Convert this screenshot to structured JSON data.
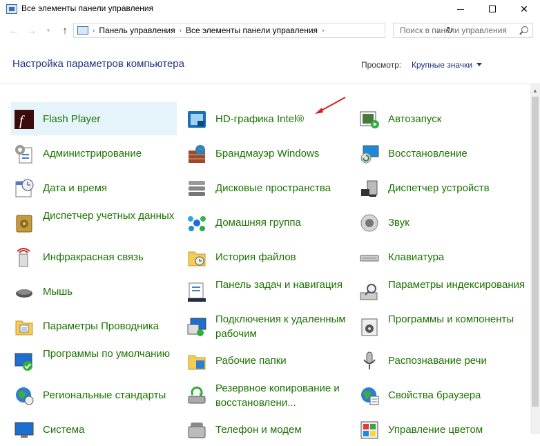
{
  "window": {
    "title": "Все элементы панели управления"
  },
  "address": {
    "crumbs": [
      "Панель управления",
      "Все элементы панели управления"
    ]
  },
  "search": {
    "placeholder": "Поиск в панели управления"
  },
  "header": {
    "title": "Настройка параметров компьютера",
    "view_label": "Просмотр:",
    "view_value": "Крупные значки"
  },
  "items": [
    {
      "label": "Flash Player",
      "icon": "flash-player-icon"
    },
    {
      "label": "HD-графика Intel®",
      "icon": "intel-graphics-icon"
    },
    {
      "label": "Автозапуск",
      "icon": "autoplay-icon"
    },
    {
      "label": "Администрирование",
      "icon": "administrative-tools-icon"
    },
    {
      "label": "Брандмауэр Windows",
      "icon": "firewall-icon"
    },
    {
      "label": "Восстановление",
      "icon": "recovery-icon"
    },
    {
      "label": "Дата и время",
      "icon": "date-time-icon"
    },
    {
      "label": "Дисковые пространства",
      "icon": "storage-spaces-icon"
    },
    {
      "label": "Диспетчер устройств",
      "icon": "device-manager-icon"
    },
    {
      "label": "Диспетчер учетных данных",
      "icon": "credential-manager-icon"
    },
    {
      "label": "Домашняя группа",
      "icon": "homegroup-icon"
    },
    {
      "label": "Звук",
      "icon": "sound-icon"
    },
    {
      "label": "Инфракрасная связь",
      "icon": "infrared-icon"
    },
    {
      "label": "История файлов",
      "icon": "file-history-icon"
    },
    {
      "label": "Клавиатура",
      "icon": "keyboard-icon"
    },
    {
      "label": "Мышь",
      "icon": "mouse-icon"
    },
    {
      "label": "Панель задач и навигация",
      "icon": "taskbar-icon"
    },
    {
      "label": "Параметры индексирования",
      "icon": "indexing-options-icon"
    },
    {
      "label": "Параметры Проводника",
      "icon": "explorer-options-icon"
    },
    {
      "label": "Подключения к удаленным рабочим",
      "icon": "remote-connections-icon"
    },
    {
      "label": "Программы и компоненты",
      "icon": "programs-features-icon"
    },
    {
      "label": "Программы по умолчанию",
      "icon": "default-programs-icon"
    },
    {
      "label": "Рабочие папки",
      "icon": "work-folders-icon"
    },
    {
      "label": "Распознавание речи",
      "icon": "speech-recognition-icon"
    },
    {
      "label": "Региональные стандарты",
      "icon": "region-icon"
    },
    {
      "label": "Резервное копирование и восстановлени...",
      "icon": "backup-restore-icon"
    },
    {
      "label": "Свойства браузера",
      "icon": "internet-options-icon"
    },
    {
      "label": "Система",
      "icon": "system-icon"
    },
    {
      "label": "Телефон и модем",
      "icon": "phone-modem-icon"
    },
    {
      "label": "Управление цветом",
      "icon": "color-management-icon"
    }
  ]
}
